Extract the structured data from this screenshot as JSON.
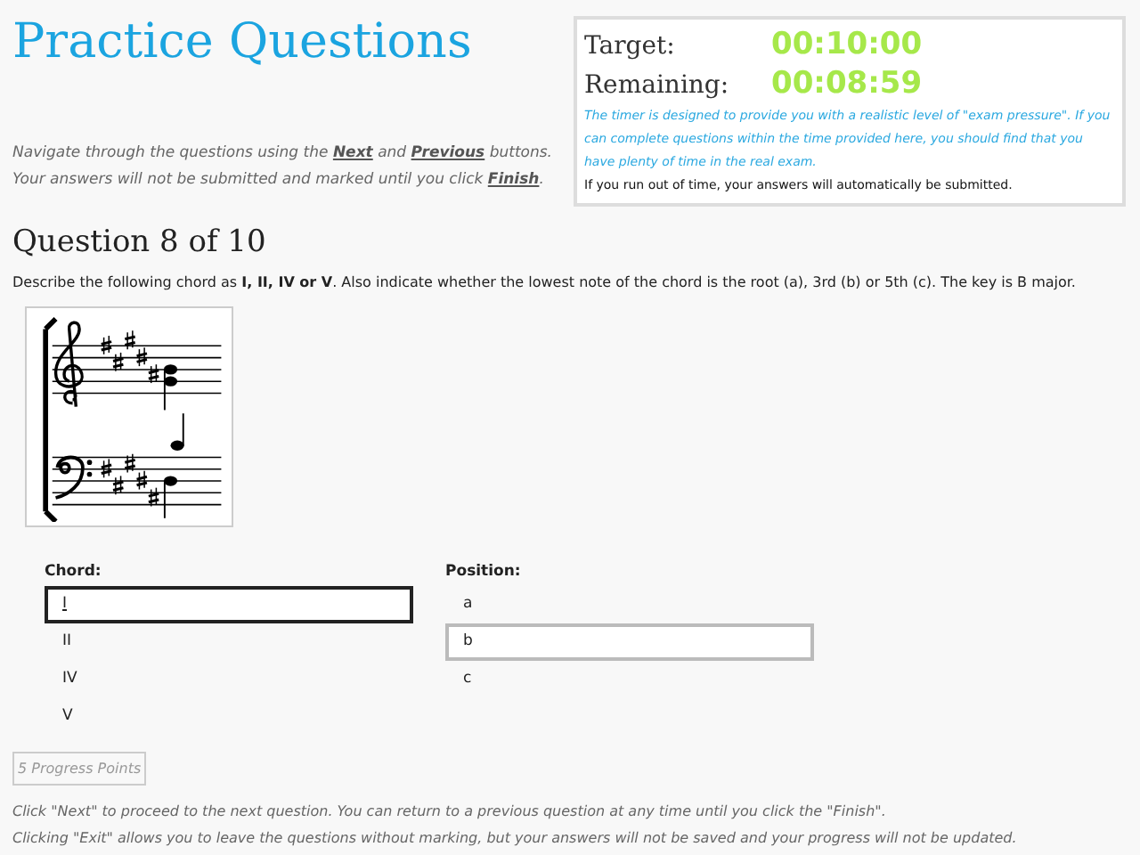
{
  "title": "Practice Questions",
  "timer": {
    "target_label": "Target:",
    "target_value": "00:10:00",
    "remaining_label": "Remaining:",
    "remaining_value": "00:08:59",
    "note": "The timer is designed to provide you with a realistic level of \"exam pressure\". If you can complete questions within the time provided here, you should find that you have plenty of time in the real exam.",
    "warning": "If you run out of time, your answers will automatically be submitted."
  },
  "navigation_help": {
    "before_next": "Navigate through the questions using the",
    "next_link": "Next",
    "between": "and",
    "previous_link": "Previous",
    "after_previous": "buttons.",
    "line2_before": "Your answers will not be submitted and marked until you click",
    "finish_link": "Finish",
    "line2_after": "."
  },
  "question_heading": "Question 8 of 10",
  "question_text": "Describe the following chord as **I, II, IV or V**. Also indicate whether the lowest note of the chord is the root (a), 3rd (b) or 5th (c). The key is B major.",
  "score": {
    "kind": "picture"
  },
  "answer_lists": [
    {
      "label": "Chord:",
      "focused": true,
      "options": [
        {
          "text": "I",
          "selected": true
        },
        {
          "text": "II",
          "selected": false
        },
        {
          "text": "IV",
          "selected": false
        },
        {
          "text": "V",
          "selected": false
        }
      ]
    },
    {
      "label": "Position:",
      "focused": false,
      "options": [
        {
          "text": "a",
          "selected": false
        },
        {
          "text": "b",
          "selected": true
        },
        {
          "text": "c",
          "selected": false
        }
      ]
    }
  ],
  "progress_points": "5 Progress Points",
  "footer": [
    "Click \"Next\" to proceed to the next question. You can return to a previous question at any time until you click the \"Finish\".",
    "Clicking \"Exit\" allows you to leave the questions without marking, but your answers will not be saved and your progress will not be updated."
  ]
}
